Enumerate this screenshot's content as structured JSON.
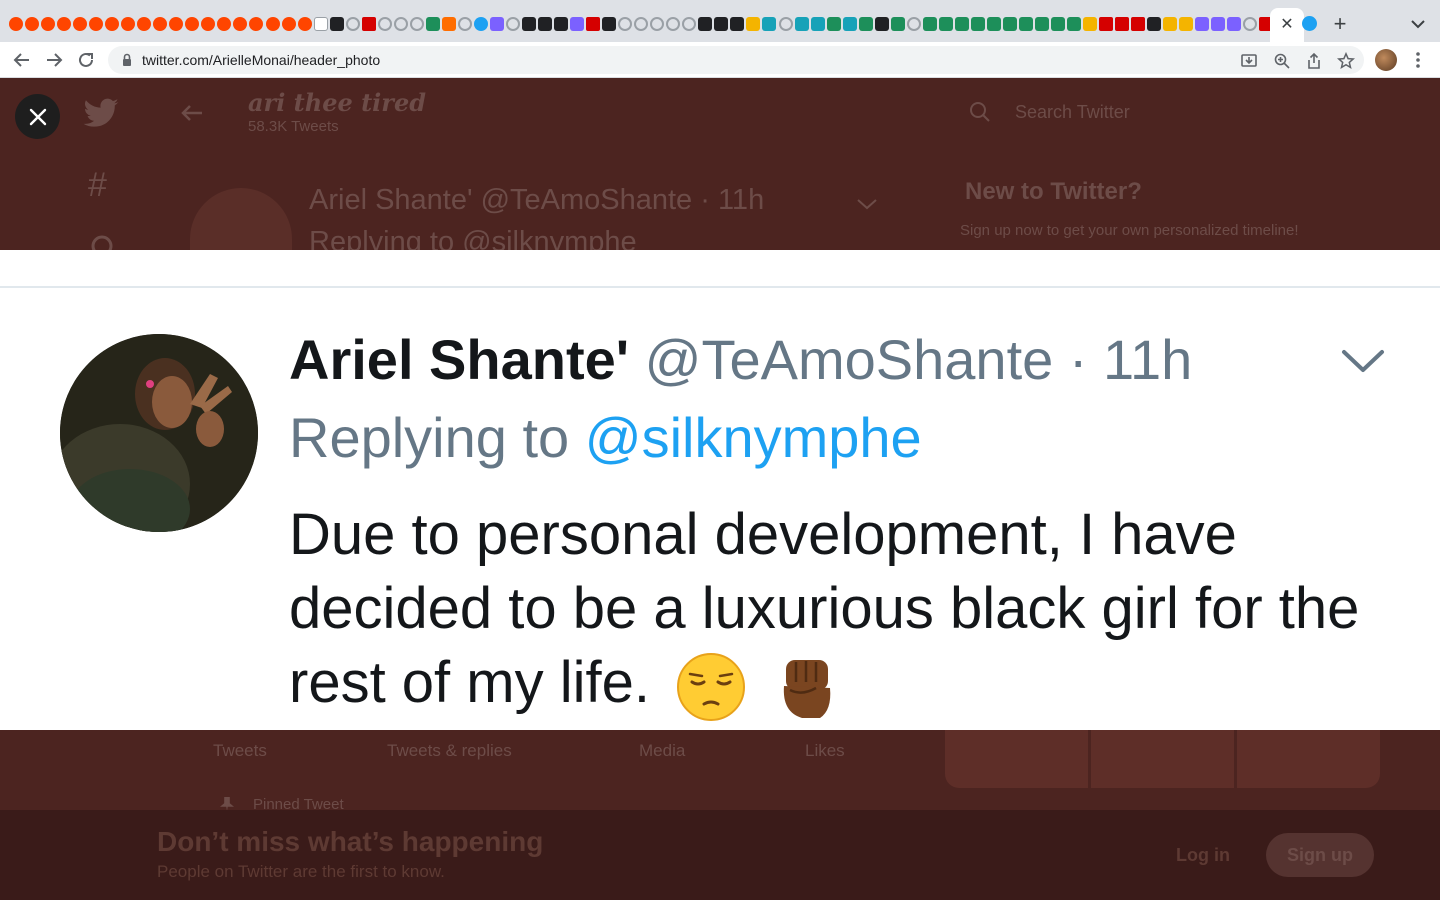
{
  "browser": {
    "url": "twitter.com/ArielleMonai/header_photo",
    "tab_favicons": [
      "r",
      "r",
      "r",
      "r",
      "r",
      "r",
      "r",
      "r",
      "r",
      "r",
      "r",
      "r",
      "r",
      "r",
      "r",
      "r",
      "r",
      "r",
      "r",
      "w",
      "k",
      "g",
      "m",
      "g",
      "g",
      "g",
      "n",
      "o",
      "g",
      "b",
      "p",
      "g",
      "k",
      "k",
      "k",
      "p",
      "m",
      "k",
      "g",
      "g",
      "g",
      "g",
      "g",
      "k",
      "k",
      "k",
      "y",
      "c",
      "g",
      "c",
      "c",
      "n",
      "c",
      "n",
      "k",
      "n",
      "g",
      "n",
      "n",
      "n",
      "n",
      "n",
      "n",
      "n",
      "n",
      "n",
      "n",
      "y",
      "m",
      "m",
      "m",
      "k",
      "y",
      "y",
      "p",
      "p",
      "p",
      "g",
      "m",
      "m",
      "m",
      "m",
      "b"
    ]
  },
  "background": {
    "profile_title": "ari thee tired",
    "tweet_count": "58.3K Tweets",
    "search_placeholder": "Search Twitter",
    "new_to_twitter": "New to Twitter?",
    "signup_prompt": "Sign up now to get your own personalized timeline!",
    "tweet_preview_name": "Ariel Shante' @TeAmoShante · 11h",
    "tweet_preview_reply": "Replying to @silknymphe",
    "tabs": [
      "Tweets",
      "Tweets & replies",
      "Media",
      "Likes"
    ],
    "pinned": "Pinned Tweet",
    "banner_title": "Don’t miss what’s happening",
    "banner_sub": "People on Twitter are the first to know.",
    "login": "Log in",
    "signup": "Sign up"
  },
  "header_photo": {
    "name": "Ariel Shante'",
    "handle": "@TeAmoShante",
    "separator": "·",
    "time": "11h",
    "reply_prefix": "Replying to",
    "reply_mention": "@silknymphe",
    "text": "Due to personal development, I have decided to be a luxurious black girl for the rest of my life.",
    "emojis": [
      "pensive-face",
      "raised-fist"
    ]
  },
  "colors": {
    "twitter_blue": "#1da1f2",
    "handle_gray": "#657786",
    "text_dark": "#14171a",
    "overlay": "#4c2420"
  }
}
